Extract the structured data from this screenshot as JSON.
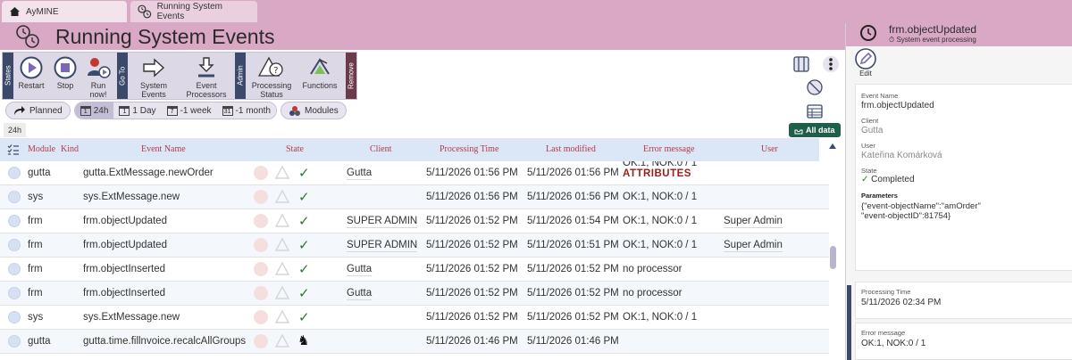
{
  "tabs": [
    {
      "label": "AyMINE",
      "icon": "home-icon"
    },
    {
      "label": "Running System Events",
      "icon": "events-icon"
    }
  ],
  "page_title": "Running System Events",
  "toolbar": {
    "states_tab": "States",
    "goto_tab": "Go To",
    "admin_tab": "Admin",
    "remove_tab": "Remove",
    "restart": "Restart",
    "stop": "Stop",
    "run_now": "Run now!",
    "system_events": "System Events",
    "event_processors": "Event Processors",
    "processing_status": "Processing Status",
    "functions": "Functions"
  },
  "filters": {
    "planned": "Planned",
    "h24": "24h",
    "day1": "1 Day",
    "week1": "-1 week",
    "month1": "-1 month",
    "modules": "Modules"
  },
  "chip_24h": "24h",
  "all_data": "All data",
  "columns": {
    "module": "Module",
    "kind": "Kind",
    "event_name": "Event Name",
    "state": "State",
    "client": "Client",
    "processing_time": "Processing Time",
    "last_modified": "Last modified",
    "error_message": "Error message",
    "user": "User"
  },
  "rows": [
    {
      "module": "gutta",
      "event": "gutta.ExtMessage.newOrder",
      "client": "Gutta",
      "proc": "5/11/2026 01:56 PM",
      "mod": "5/11/2026 01:56 PM",
      "err": "OK:1, NOK:0 / 1",
      "err2": "ATTRIBUTES",
      "user": "",
      "state": "check"
    },
    {
      "module": "sys",
      "event": "sys.ExtMessage.new",
      "client": "",
      "proc": "5/11/2026 01:56 PM",
      "mod": "5/11/2026 01:56 PM",
      "err": "OK:1, NOK:0 / 1",
      "err2": "",
      "user": "",
      "state": "check"
    },
    {
      "module": "frm",
      "event": "frm.objectUpdated",
      "client": "SUPER ADMIN",
      "proc": "5/11/2026 01:52 PM",
      "mod": "5/11/2026 01:54 PM",
      "err": "OK:1, NOK:0 / 1",
      "err2": "",
      "user": "Super Admin",
      "state": "check"
    },
    {
      "module": "frm",
      "event": "frm.objectUpdated",
      "client": "SUPER ADMIN",
      "proc": "5/11/2026 01:52 PM",
      "mod": "5/11/2026 01:51 PM",
      "err": "OK:1, NOK:0 / 1",
      "err2": "",
      "user": "Super Admin",
      "state": "check"
    },
    {
      "module": "frm",
      "event": "frm.objectInserted",
      "client": "Gutta",
      "proc": "5/11/2026 01:52 PM",
      "mod": "5/11/2026 01:52 PM",
      "err": "no processor",
      "err2": "",
      "user": "",
      "state": "check"
    },
    {
      "module": "frm",
      "event": "frm.objectInserted",
      "client": "Gutta",
      "proc": "5/11/2026 01:52 PM",
      "mod": "5/11/2026 01:52 PM",
      "err": "no processor",
      "err2": "",
      "user": "",
      "state": "check"
    },
    {
      "module": "sys",
      "event": "sys.ExtMessage.new",
      "client": "",
      "proc": "5/11/2026 01:52 PM",
      "mod": "5/11/2026 01:52 PM",
      "err": "OK:1, NOK:0 / 1",
      "err2": "",
      "user": "",
      "state": "check"
    },
    {
      "module": "gutta",
      "event": "gutta.time.fillnvoice.recalcAllGroups",
      "client": "",
      "proc": "5/11/2026 01:46 PM",
      "mod": "5/11/2026 01:46 PM",
      "err": "",
      "err2": "",
      "user": "",
      "state": "horse"
    }
  ],
  "panel": {
    "title": "frm.objectUpdated",
    "subtitle": "System event processing",
    "edit": "Edit",
    "event_name_label": "Event Name",
    "event_name": "frm.objectUpdated",
    "client_label": "Client",
    "client": "Gutta",
    "user_label": "User",
    "user": "Kateřina Komárková",
    "state_label": "State",
    "state": "Completed",
    "params_label": "Parameters",
    "params_line1": "{\"event-objectName\":\"amOrder\"",
    "params_line2": "\"event-objectID\":81754}",
    "proc_label": "Processing Time",
    "proc": "5/11/2026 02:34 PM",
    "err_label": "Error message",
    "err": "OK:1, NOK:0 / 1"
  },
  "colors": {
    "accent": "#d9a8c4",
    "nav": "#3b4a6b",
    "header_text": "#b43c4c",
    "alldata": "#1f5e49"
  }
}
